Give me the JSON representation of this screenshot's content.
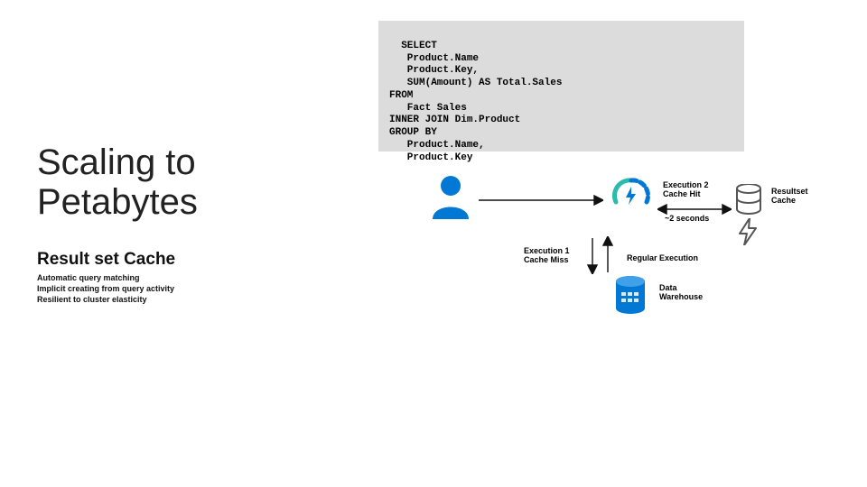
{
  "sql": "SELECT\n   Product.Name\n   Product.Key,\n   SUM(Amount) AS Total.Sales\nFROM\n   Fact Sales\nINNER JOIN Dim.Product\nGROUP BY\n   Product.Name,\n   Product.Key",
  "title": "Scaling to\nPetabytes",
  "subtitle": "Result set Cache",
  "bullets": "Automatic query matching\nImplicit creating from query activity\nResilient to cluster elasticity",
  "labels": {
    "exec2": "Execution 2\nCache Hit",
    "seconds": "~2 seconds",
    "rs_cache": "Resultset\nCache",
    "exec1": "Execution 1\nCache Miss",
    "regular": "Regular Execution",
    "dw": "Data\nWarehouse"
  },
  "colors": {
    "azure_blue": "#0078d4",
    "teal": "#2bbbad",
    "dark": "#111111"
  }
}
